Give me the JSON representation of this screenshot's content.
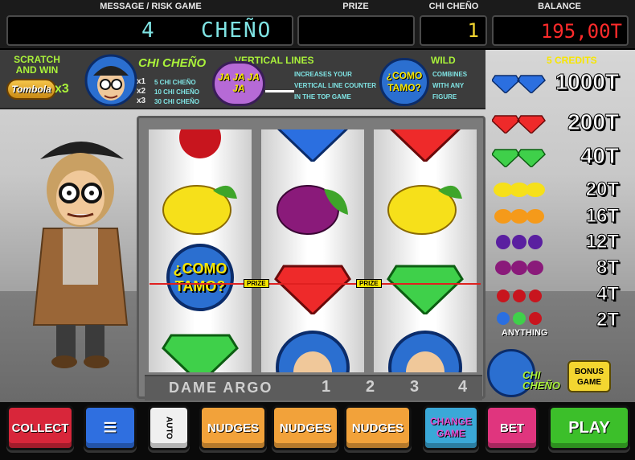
{
  "header": {
    "message_label": "MESSAGE / RISK GAME",
    "prize_label": "PRIZE",
    "chicheno_label": "CHI CHEÑO",
    "balance_label": "BALANCE",
    "message_number": "4",
    "message_text": "CHEÑO",
    "prize_value": "",
    "chicheno_value": "1",
    "balance_value": "195,00T"
  },
  "info": {
    "scratch_title": "SCRATCH AND WIN",
    "tombola": "Tombola",
    "x3": "x3",
    "chicheno_title": "CHI CHEÑO",
    "m1": "x1",
    "m2": "x2",
    "m3": "x3",
    "c1": "5 CHI CHEÑO",
    "c2": "10 CHI CHEÑO",
    "c3": "30 CHI CHEÑO",
    "vertical_title": "VERTICAL LINES",
    "jajaja": "JA JA JA JA",
    "vertical_desc1": "INCREASES YOUR",
    "vertical_desc2": "VERTICAL LINE COUNTER",
    "vertical_desc3": "IN THE TOP GAME",
    "wild_title": "WILD",
    "wild_badge": "¿COMO TAMO?",
    "wild_desc1": "COMBINES",
    "wild_desc2": "WITH ANY",
    "wild_desc3": "FIGURE"
  },
  "reels": {
    "prize_tag_1": "PRIZE",
    "prize_tag_2": "PRIZE",
    "wild_text": "¿COMO TAMO?",
    "dame_argo": "DAME ARGO",
    "lever_numbers": [
      "1",
      "2",
      "3",
      "4"
    ]
  },
  "paytable": {
    "credits": "5 CREDITS",
    "rows": [
      {
        "symbol": "blue-diamond",
        "value": "1000T"
      },
      {
        "symbol": "red-diamond",
        "value": "200T"
      },
      {
        "symbol": "green-diamond",
        "value": "40T"
      },
      {
        "symbol": "lemon",
        "value": "20T"
      },
      {
        "symbol": "orange",
        "value": "16T"
      },
      {
        "symbol": "grapes",
        "value": "12T"
      },
      {
        "symbol": "plum",
        "value": "8T"
      },
      {
        "symbol": "cherry",
        "value": "4T"
      },
      {
        "symbol": "anything",
        "value": "2T"
      }
    ],
    "anything_label": "ANYTHING",
    "bonus_label": "BONUS GAME",
    "logo_text": "CHI CHEÑO"
  },
  "buttons": {
    "collect": "COLLECT",
    "menu": "≡",
    "auto": "AUTO",
    "nudges1": "NUDGES",
    "nudges2": "NUDGES",
    "nudges3": "NUDGES",
    "change_game": "CHANGE GAME",
    "bet": "BET",
    "play": "PLAY"
  },
  "colors": {
    "balance_red": "#ff2b2b",
    "lcd_cyan": "#7fe3e3",
    "info_green": "#aaf23a",
    "collect_red": "#d8263a",
    "menu_blue": "#2f6fe0",
    "nudges_orange": "#f2a23a",
    "change_blue": "#3aa8d8",
    "bet_pink": "#e0357e",
    "play_green": "#3cbf2a"
  }
}
